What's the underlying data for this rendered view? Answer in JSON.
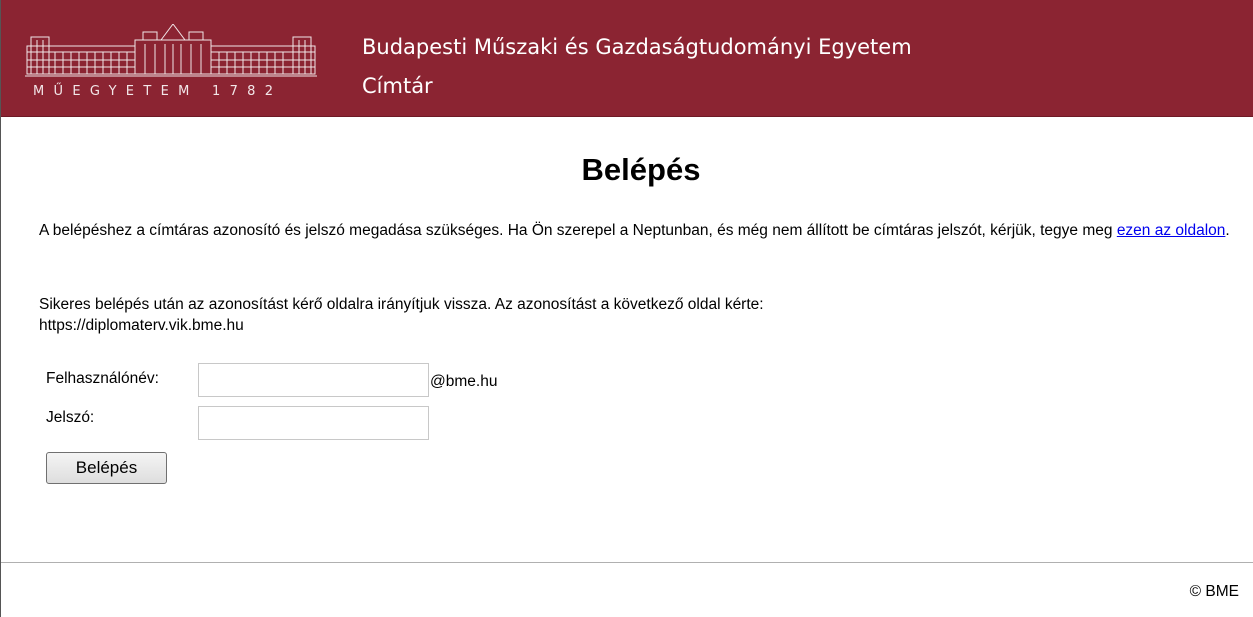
{
  "header": {
    "logo_text": "MŰEGYETEM 1782",
    "title": "Budapesti Műszaki és Gazdaságtudományi Egyetem",
    "subtitle": "Címtár",
    "background_color": "#8b2432"
  },
  "main": {
    "heading": "Belépés",
    "paragraph1_text": "A belépéshez a címtáras azonosító és jelszó megadása szükséges. Ha Ön szerepel a Neptunban, és még nem állított be címtáras jelszót, kérjük, tegye meg ",
    "paragraph1_link": "ezen az oldalon",
    "paragraph1_end": ".",
    "paragraph2_text": "Sikeres belépés után az azonosítást kérő oldalra irányítjuk vissza. Az azonosítást a következő oldal kérte:",
    "paragraph2_url": "https://diplomaterv.vik.bme.hu"
  },
  "form": {
    "username_label": "Felhasználónév:",
    "username_value": "",
    "domain_suffix": "@bme.hu",
    "password_label": "Jelszó:",
    "password_value": "",
    "submit_label": "Belépés"
  },
  "footer": {
    "copyright": "© BME"
  }
}
